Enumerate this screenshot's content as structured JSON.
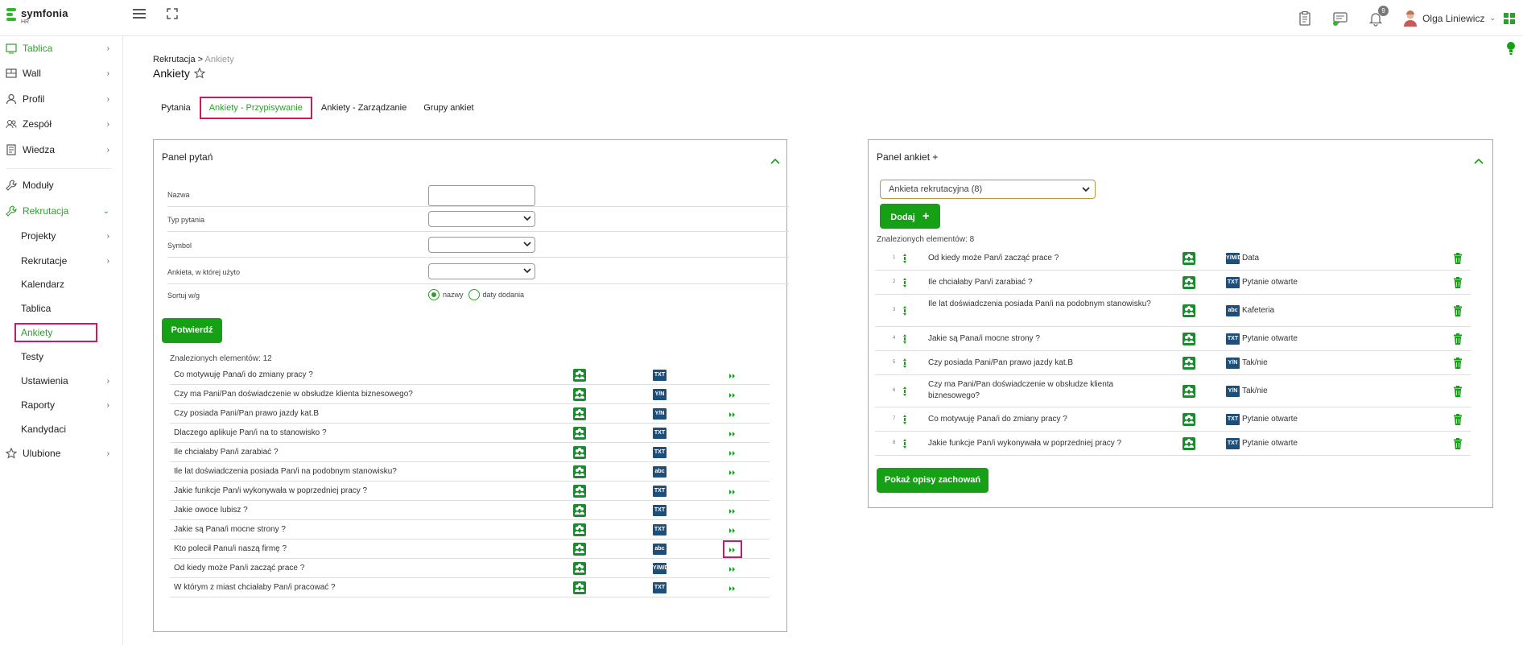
{
  "app": {
    "logo_text": "symfonia",
    "logo_sub": "HR",
    "user_name": "Olga Liniewicz",
    "notifications_count": "9"
  },
  "sidebar": {
    "items": [
      {
        "label": "Tablica",
        "icon": "dashboard-icon"
      },
      {
        "label": "Wall",
        "icon": "wall-icon"
      },
      {
        "label": "Profil",
        "icon": "user-icon"
      },
      {
        "label": "Zespół",
        "icon": "team-icon"
      },
      {
        "label": "Wiedza",
        "icon": "book-icon"
      },
      {
        "label": "Moduły",
        "icon": "wrench-icon"
      },
      {
        "label": "Rekrutacja",
        "icon": "wrench-icon"
      },
      {
        "label": "Projekty"
      },
      {
        "label": "Rekrutacje"
      },
      {
        "label": "Kalendarz"
      },
      {
        "label": "Tablica"
      },
      {
        "label": "Ankiety"
      },
      {
        "label": "Testy"
      },
      {
        "label": "Ustawienia"
      },
      {
        "label": "Raporty"
      },
      {
        "label": "Kandydaci"
      },
      {
        "label": "Ulubione",
        "icon": "star-icon"
      }
    ]
  },
  "breadcrumb": {
    "parent": "Rekrutacja",
    "separator": ">",
    "current": "Ankiety"
  },
  "page_title": "Ankiety",
  "tabs": [
    "Pytania",
    "Ankiety - Przypisywanie",
    "Ankiety - Zarządzanie",
    "Grupy ankiet"
  ],
  "panel_questions": {
    "title": "Panel pytań",
    "form": {
      "name_label": "Nazwa",
      "type_label": "Typ pytania",
      "symbol_label": "Symbol",
      "survey_used_label": "Ankieta, w której użyto",
      "sort_label": "Sortuj w/g",
      "sort_option_name": "nazwy",
      "sort_option_date": "daty dodania"
    },
    "confirm_button": "Potwierdź",
    "found_label": "Znalezionych elementów: 12",
    "questions": [
      {
        "text": "Co motywuję Pana/i do zmiany pracy ?",
        "type": "TXT"
      },
      {
        "text": "Czy ma Pani/Pan doświadczenie w obsłudze klienta biznesowego?",
        "type": "Y/N"
      },
      {
        "text": "Czy posiada Pani/Pan prawo jazdy kat.B",
        "type": "Y/N"
      },
      {
        "text": "Dlaczego aplikuje Pan/i na to stanowisko ?",
        "type": "TXT"
      },
      {
        "text": "Ile chciałaby Pan/i zarabiać ?",
        "type": "TXT"
      },
      {
        "text": "Ile lat doświadczenia posiada Pan/i na podobnym stanowisku?",
        "type": "abc"
      },
      {
        "text": "Jakie funkcje Pan/i wykonywała w poprzedniej pracy ?",
        "type": "TXT"
      },
      {
        "text": "Jakie owoce lubisz ?",
        "type": "TXT"
      },
      {
        "text": "Jakie są Pana/i mocne strony ?",
        "type": "TXT"
      },
      {
        "text": "Kto polecił Panu/i naszą firmę ?",
        "type": "abc"
      },
      {
        "text": "Od kiedy może Pan/i zacząć prace ?",
        "type": "Y/M/D"
      },
      {
        "text": "W którym z miast chciałaby Pan/i pracować ?",
        "type": "TXT"
      }
    ]
  },
  "panel_surveys": {
    "title": "Panel ankiet +",
    "selected_survey": "Ankieta rekrutacyjna (8)",
    "add_button": "Dodaj",
    "found_label": "Znalezionych elementów: 8",
    "show_button": "Pokaż opisy zachowań",
    "questions": [
      {
        "num": "1",
        "text": "Od kiedy może Pan/i zacząć prace ?",
        "type": "Y/M/D",
        "type_label": "Data"
      },
      {
        "num": "2",
        "text": "Ile chciałaby Pan/i zarabiać ?",
        "type": "TXT",
        "type_label": "Pytanie otwarte"
      },
      {
        "num": "3",
        "text": "Ile lat doświadczenia posiada Pan/i na podobnym stanowisku?",
        "type": "abc",
        "type_label": "Kafeteria"
      },
      {
        "num": "4",
        "text": "Jakie są Pana/i mocne strony ?",
        "type": "TXT",
        "type_label": "Pytanie otwarte"
      },
      {
        "num": "5",
        "text": "Czy posiada Pani/Pan prawo jazdy kat.B",
        "type": "Y/N",
        "type_label": "Tak/nie"
      },
      {
        "num": "6",
        "text": "Czy ma Pani/Pan doświadczenie w obsłudze klienta biznesowego?",
        "type": "Y/N",
        "type_label": "Tak/nie"
      },
      {
        "num": "7",
        "text": "Co motywuję Pana/i do zmiany pracy ?",
        "type": "TXT",
        "type_label": "Pytanie otwarte"
      },
      {
        "num": "8",
        "text": "Jakie funkcje Pan/i wykonywała w poprzedniej pracy ?",
        "type": "TXT",
        "type_label": "Pytanie otwarte"
      }
    ]
  },
  "colors": {
    "accent": "#16a016",
    "highlight": "#d0185a",
    "type_badge": "#1d4f7c"
  }
}
